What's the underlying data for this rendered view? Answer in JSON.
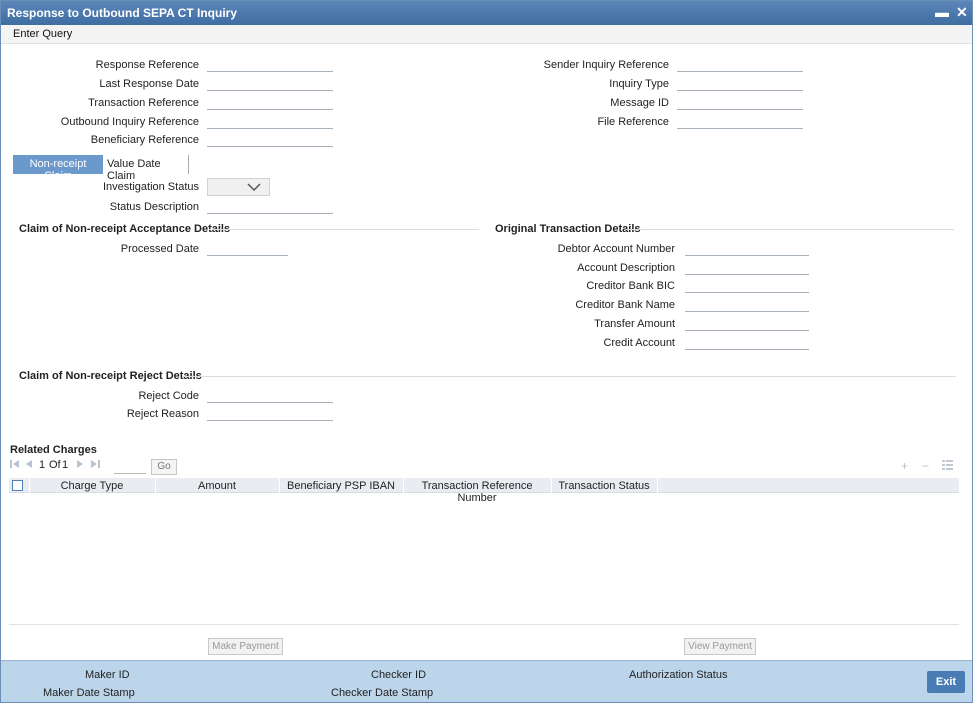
{
  "window": {
    "title": "Response to Outbound SEPA CT Inquiry",
    "minimize_glyph": "▬",
    "close_glyph": "✕"
  },
  "menu": {
    "enter_query": "Enter Query"
  },
  "header_fields": {
    "left": [
      {
        "label": "Response Reference",
        "value": ""
      },
      {
        "label": "Last Response Date",
        "value": ""
      },
      {
        "label": "Transaction Reference",
        "value": ""
      },
      {
        "label": "Outbound Inquiry Reference",
        "value": ""
      },
      {
        "label": "Beneficiary Reference",
        "value": ""
      }
    ],
    "right": [
      {
        "label": "Sender Inquiry Reference",
        "value": ""
      },
      {
        "label": "Inquiry Type",
        "value": ""
      },
      {
        "label": "Message ID",
        "value": ""
      },
      {
        "label": "File Reference",
        "value": ""
      }
    ]
  },
  "tabs": [
    {
      "label": "Non-receipt Claim",
      "active": true
    },
    {
      "label": "Value Date Claim",
      "active": false
    }
  ],
  "investigation": {
    "status_label": "Investigation Status",
    "status_value": "",
    "description_label": "Status Description",
    "description_value": ""
  },
  "acceptance": {
    "title": "Claim of Non-receipt Acceptance Details",
    "processed_date_label": "Processed Date",
    "processed_date_value": ""
  },
  "original_txn": {
    "title": "Original Transaction Details",
    "fields": [
      {
        "label": "Debtor Account Number",
        "value": ""
      },
      {
        "label": "Account Description",
        "value": ""
      },
      {
        "label": "Creditor Bank BIC",
        "value": ""
      },
      {
        "label": "Creditor Bank Name",
        "value": ""
      },
      {
        "label": "Transfer Amount",
        "value": ""
      },
      {
        "label": "Credit Account",
        "value": ""
      }
    ]
  },
  "reject": {
    "title": "Claim of Non-receipt Reject Details",
    "code_label": "Reject Code",
    "code_value": "",
    "reason_label": "Reject Reason",
    "reason_value": ""
  },
  "related_charges": {
    "title": "Related Charges",
    "pager": {
      "current": "1",
      "of_label": "Of",
      "total": "1",
      "go_label": "Go"
    },
    "columns": [
      "Charge Type",
      "Amount",
      "Beneficiary PSP IBAN",
      "Transaction Reference Number",
      "Transaction Status"
    ],
    "rows": []
  },
  "buttons": {
    "make_payment": "Make Payment",
    "view_payment": "View Payment",
    "exit": "Exit"
  },
  "footer": {
    "maker_id": "Maker ID",
    "maker_date_stamp": "Maker Date Stamp",
    "checker_id": "Checker ID",
    "checker_date_stamp": "Checker Date Stamp",
    "authorization_status": "Authorization Status"
  }
}
